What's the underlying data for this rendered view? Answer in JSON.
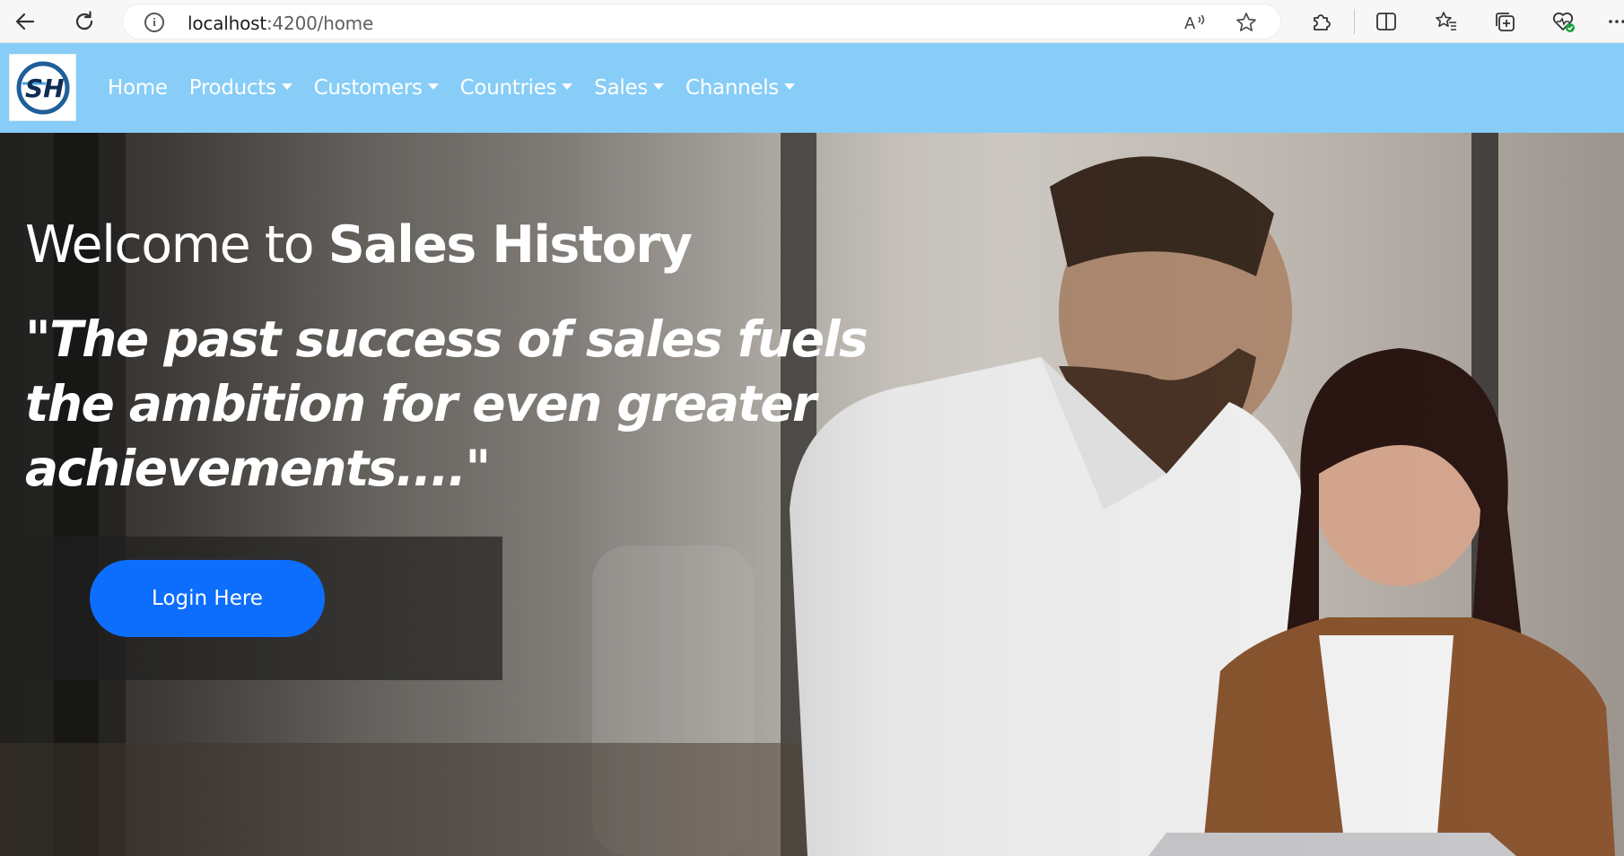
{
  "browser": {
    "url_host": "localhost",
    "url_path": ":4200/home",
    "icons": [
      "back-icon",
      "reload-icon",
      "info-icon",
      "read-aloud-icon",
      "favorite-star-icon",
      "extensions-icon",
      "split-screen-icon",
      "favorites-icon",
      "collections-icon",
      "browser-health-icon",
      "more-icon"
    ]
  },
  "navbar": {
    "logo_text": "SH",
    "items": [
      {
        "label": "Home",
        "dropdown": false
      },
      {
        "label": "Products",
        "dropdown": true
      },
      {
        "label": "Customers",
        "dropdown": true
      },
      {
        "label": "Countries",
        "dropdown": true
      },
      {
        "label": "Sales",
        "dropdown": true
      },
      {
        "label": "Channels",
        "dropdown": true
      }
    ],
    "background": "#87cdf7"
  },
  "hero": {
    "welcome_prefix": "Welcome to ",
    "welcome_brand": "Sales History",
    "quote": "\"The past success of sales fuels the ambition for even greater achievements....\"",
    "login_label": "Login Here",
    "button_color": "#0d6efd"
  }
}
